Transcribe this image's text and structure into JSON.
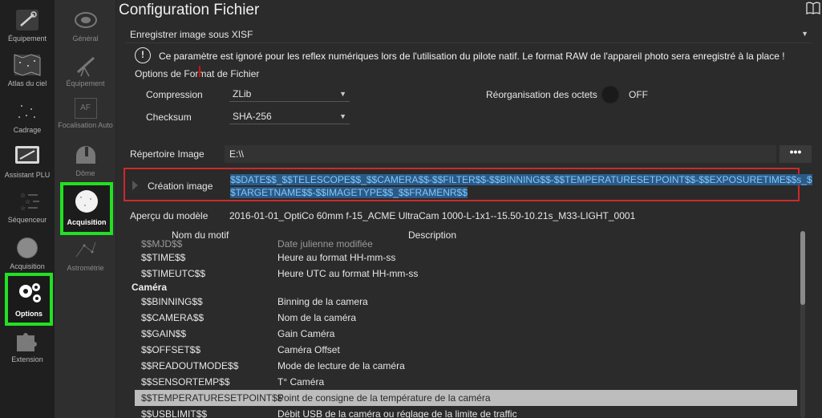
{
  "nav": {
    "items": [
      {
        "label": "Équipement"
      },
      {
        "label": "Atlas du ciel"
      },
      {
        "label": "Cadrage"
      },
      {
        "label": "Assistant PLU"
      },
      {
        "label": "Séquenceur"
      },
      {
        "label": "Acquisition"
      },
      {
        "label": "Options"
      },
      {
        "label": "Extension"
      }
    ]
  },
  "subnav": {
    "items": [
      {
        "label": "Général"
      },
      {
        "label": "Équipement"
      },
      {
        "label": "Focalisation Auto"
      },
      {
        "label": "Dôme"
      },
      {
        "label": "Acquisition"
      },
      {
        "label": "Astrométrie"
      }
    ],
    "af_text": "AF"
  },
  "main": {
    "title": "Configuration Fichier",
    "save_format": "Enregistrer image sous XISF",
    "info_text": "Ce paramètre est ignoré pour les reflex numériques lors de l'utilisation du pilote natif. Le format RAW de l'appareil photo sera enregistré à la place !",
    "options_label": "Options de Format de Fichier",
    "compression_label": "Compression",
    "compression_value": "ZLib",
    "checksum_label": "Checksum",
    "checksum_value": "SHA-256",
    "byte_shuffle_label": "Réorganisation des octets",
    "byte_shuffle_value": "OFF",
    "image_dir_label": "Répertoire Image",
    "image_dir_value": "E:\\\\",
    "browse_label": "•••",
    "creation_label": "Création image",
    "creation_value_line1": "$$DATE$$_$$TELESCOPE$$_$$CAMERA$$-$$FILTER$$-$$BINNING$$-$$TEMPERATURESETPOINT$$-$$EXPOSURETIME$$s_$",
    "creation_value_line2": "$TARGETNAME$$-$$IMAGETYPE$$_$$FRAMENR$$",
    "preview_label": "Aperçu du modèle",
    "preview_value": "2016-01-01_OptiCo 60mm f-15_ACME UltraCam 1000-L-1x1--15.50-10.21s_M33-LIGHT_0001"
  },
  "table": {
    "headers": {
      "name": "Nom du motif",
      "desc": "Description"
    },
    "partial_row": {
      "name": "$$MJD$$",
      "desc": "Date julienne modifiée"
    },
    "rows_top": [
      {
        "name": "$$TIME$$",
        "desc": "Heure au format HH-mm-ss"
      },
      {
        "name": "$$TIMEUTC$$",
        "desc": "Heure UTC au format HH-mm-ss"
      }
    ],
    "group": "Caméra",
    "rows": [
      {
        "name": "$$BINNING$$",
        "desc": "Binning de la camera"
      },
      {
        "name": "$$CAMERA$$",
        "desc": "Nom de la caméra"
      },
      {
        "name": "$$GAIN$$",
        "desc": "Gain Caméra"
      },
      {
        "name": "$$OFFSET$$",
        "desc": "Caméra Offset"
      },
      {
        "name": "$$READOUTMODE$$",
        "desc": "Mode de lecture de la caméra"
      },
      {
        "name": "$$SENSORTEMP$$",
        "desc": "T° Caméra"
      },
      {
        "name": "$$TEMPERATURESETPOINT$$",
        "desc": "Point de consigne de la température de la caméra"
      },
      {
        "name": "$$USBLIMIT$$",
        "desc": "Débit USB de la caméra ou réglage de la limite de traffic"
      }
    ]
  },
  "colors": {
    "highlight_green": "#22e022",
    "highlight_red": "#cc2a2a",
    "selection_bg": "#2c5a86",
    "selection_text": "#7fc8ff",
    "row_selected": "#bdbdbd"
  }
}
